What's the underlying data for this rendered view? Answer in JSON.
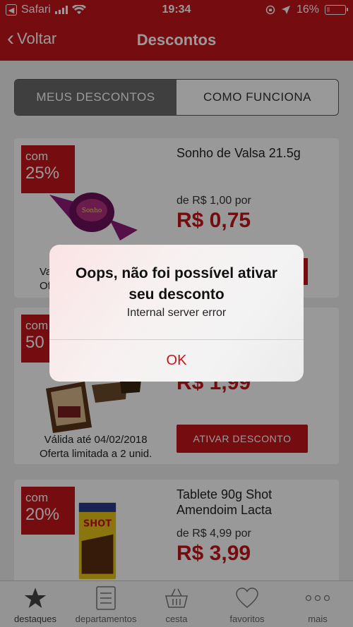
{
  "status_bar": {
    "carrier": "Safari",
    "time": "19:34",
    "battery": "16%",
    "battery_level": 0.16
  },
  "nav": {
    "back_label": "Voltar",
    "title": "Descontos"
  },
  "segments": [
    {
      "label": "MEUS DESCONTOS",
      "active": true
    },
    {
      "label": "COMO FUNCIONA",
      "active": false
    }
  ],
  "cards": [
    {
      "badge_prefix": "com",
      "badge_pct": "25%",
      "name": "Sonho de Valsa 21.5g",
      "old_price": "de R$ 1,00 por",
      "new_price": "R$ 0,75",
      "valid_prefix": "Va",
      "limit_prefix": "Of"
    },
    {
      "badge_prefix": "com",
      "badge_pct": "50",
      "new_price": "R$ 1,99",
      "valid": "Válida até 04/02/2018",
      "limit": "Oferta limitada a 2 unid.",
      "button": "ATIVAR DESCONTO"
    },
    {
      "badge_prefix": "com",
      "badge_pct": "20%",
      "name": "Tablete 90g Shot Amendoim Lacta",
      "old_price": "de R$ 4,99 por",
      "new_price": "R$ 3,99"
    }
  ],
  "tabbar": [
    {
      "label": "destaques",
      "icon": "star-icon",
      "active": true
    },
    {
      "label": "departamentos",
      "icon": "list-icon",
      "active": false
    },
    {
      "label": "cesta",
      "icon": "basket-icon",
      "active": false
    },
    {
      "label": "favoritos",
      "icon": "heart-icon",
      "active": false
    },
    {
      "label": "mais",
      "icon": "more-icon",
      "active": false
    }
  ],
  "alert": {
    "title": "Oops, não foi possível ativar seu desconto",
    "message": "Internal server error",
    "button": "OK"
  },
  "colors": {
    "brand": "#c4141c",
    "dim_overlay": "rgba(0,0,0,0.4)"
  }
}
